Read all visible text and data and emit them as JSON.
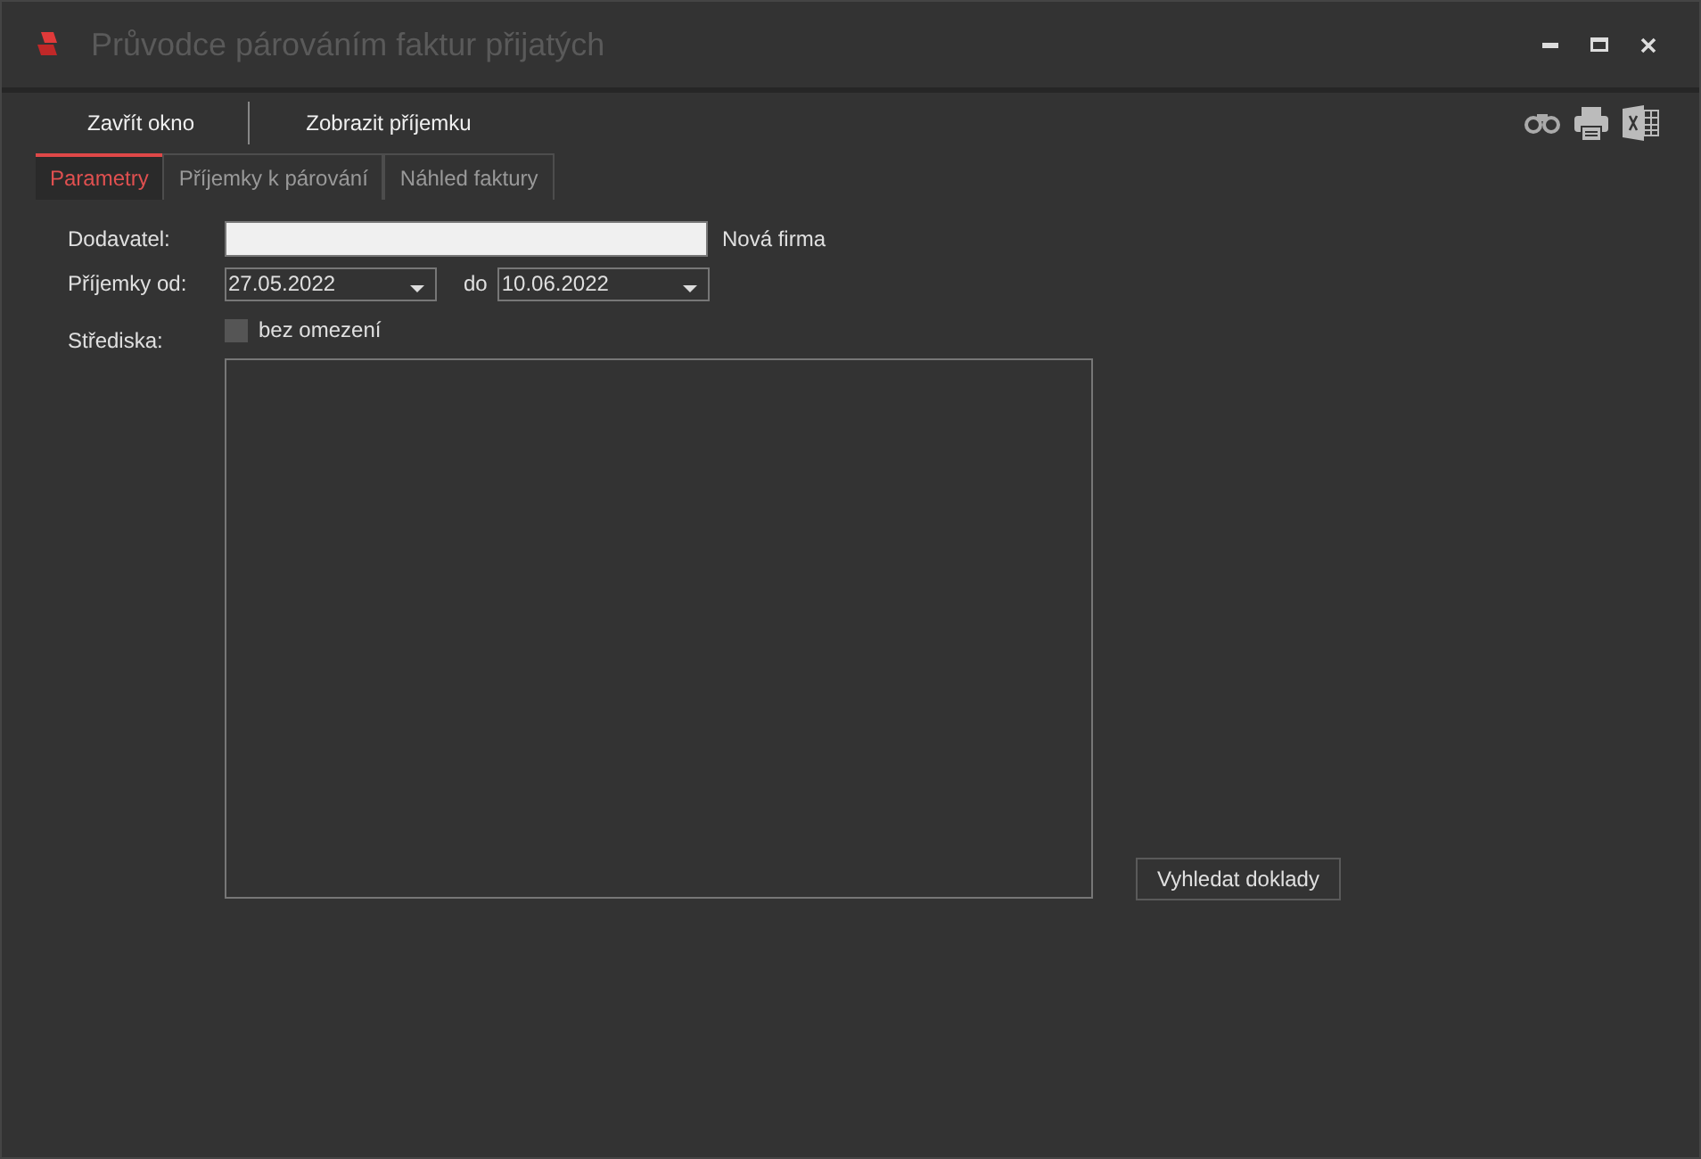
{
  "window": {
    "title": "Průvodce párováním faktur přijatých"
  },
  "toolbar": {
    "buttons": [
      "Zavřít okno",
      "Zobrazit příjemku"
    ]
  },
  "tabs": [
    {
      "label": "Parametry",
      "selected": true
    },
    {
      "label": "Příjemky k párování",
      "selected": false
    },
    {
      "label": "Náhled faktury",
      "selected": false
    }
  ],
  "form": {
    "supplier_label": "Dodavatel:",
    "new_company_link": "Nová firma",
    "date_from_label": "Příjemky od:",
    "date_from": "27.05.2022",
    "date_to_label": "do",
    "date_to": "10.06.2022",
    "centers_label": "Střediska:",
    "no_limit": {
      "label": "bez omezení",
      "checked": false
    }
  },
  "search_button": "Vyhledat doklady"
}
